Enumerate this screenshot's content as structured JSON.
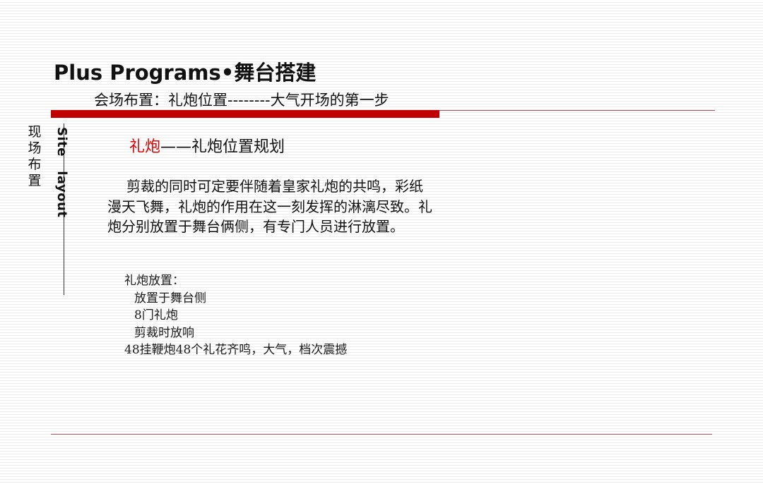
{
  "title": "Plus  Programs•舞台搭建",
  "subtitle": "会场布置：礼炮位置--------大气开场的第一步",
  "sidebar": {
    "chinese": "现场布置",
    "english": "Site   layout"
  },
  "section": {
    "heading_red": "礼炮",
    "heading_rest": "——礼炮位置规划",
    "paragraph": "剪裁的同时可定要伴随着皇家礼炮的共鸣，彩纸漫天飞舞，礼炮的作用在这一刻发挥的淋漓尽致。礼炮分别放置于舞台俩侧，有专门人员进行放置。"
  },
  "list": {
    "label": "礼炮放置：",
    "items": [
      "放置于舞台侧",
      "8门礼炮",
      "剪裁时放响",
      "48挂鞭炮48个礼花齐鸣，大气，档次震撼"
    ]
  },
  "colors": {
    "accent_red": "#c00000",
    "heading_red": "#e00000"
  }
}
